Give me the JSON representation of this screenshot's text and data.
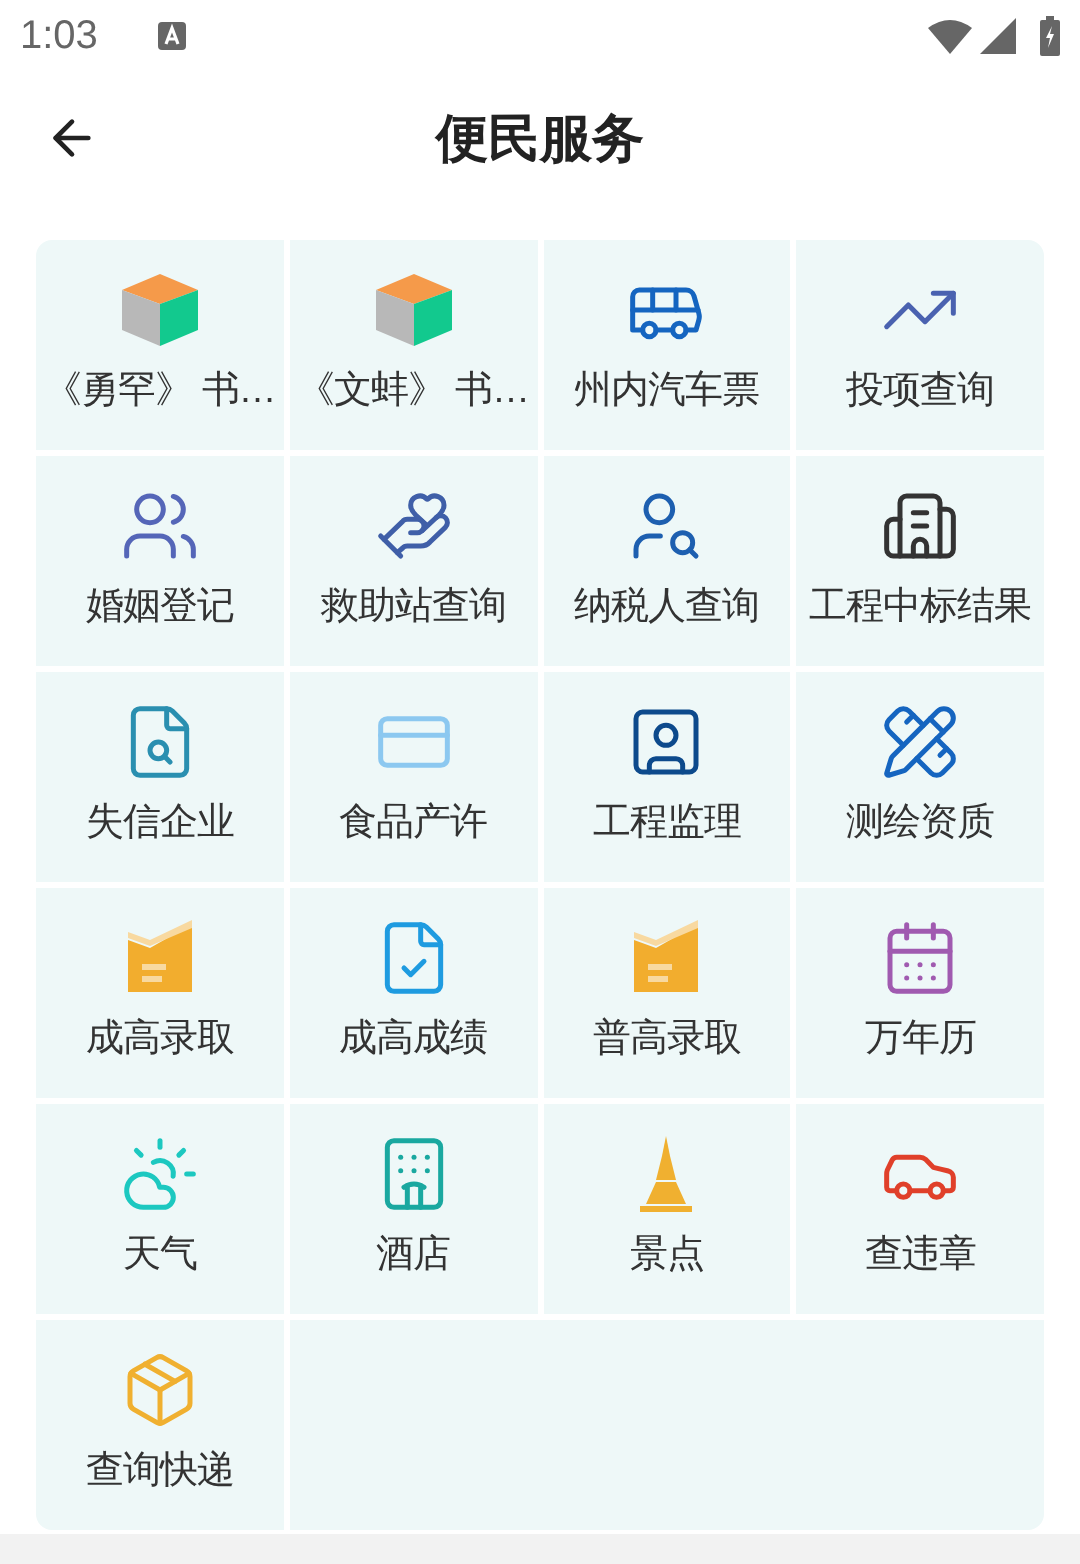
{
  "status_bar": {
    "time": "1:03"
  },
  "header": {
    "title": "便民服务"
  },
  "services": [
    {
      "label": "《勇罕》 书…",
      "kind": "cube"
    },
    {
      "label": "《文蚌》 书…",
      "kind": "cube"
    },
    {
      "label": "州内汽车票",
      "kind": "bus"
    },
    {
      "label": "投项查询",
      "kind": "trend"
    },
    {
      "label": "婚姻登记",
      "kind": "couple"
    },
    {
      "label": "救助站查询",
      "kind": "aid"
    },
    {
      "label": "纳税人查询",
      "kind": "person"
    },
    {
      "label": "工程中标结果",
      "kind": "building"
    },
    {
      "label": "失信企业",
      "kind": "record"
    },
    {
      "label": "食品产许",
      "kind": "card"
    },
    {
      "label": "工程监理",
      "kind": "badge"
    },
    {
      "label": "测绘资质",
      "kind": "survey"
    },
    {
      "label": "成高录取",
      "kind": "folder"
    },
    {
      "label": "成高成绩",
      "kind": "score"
    },
    {
      "label": "普高录取",
      "kind": "folder"
    },
    {
      "label": "万年历",
      "kind": "calendar"
    },
    {
      "label": "天气",
      "kind": "weather"
    },
    {
      "label": "酒店",
      "kind": "hotel"
    },
    {
      "label": "景点",
      "kind": "tower"
    },
    {
      "label": "查违章",
      "kind": "car"
    },
    {
      "label": "查询快递",
      "kind": "parcel"
    }
  ]
}
